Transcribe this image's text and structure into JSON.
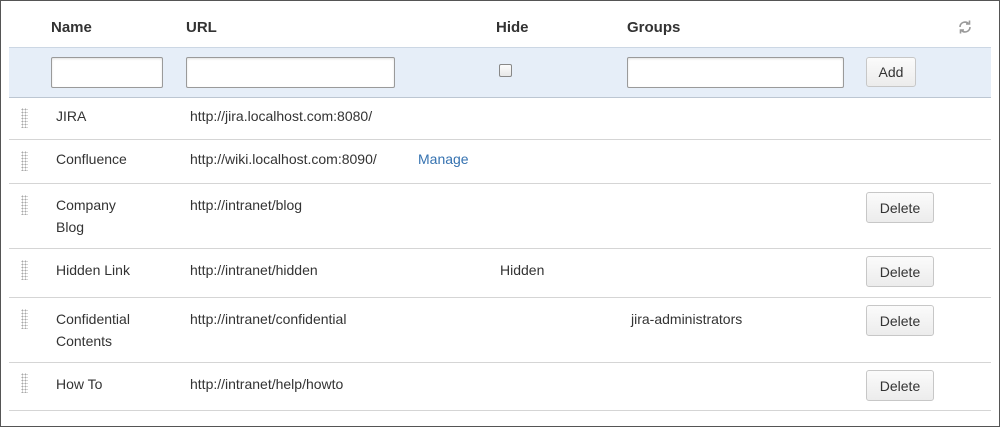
{
  "columns": {
    "name": "Name",
    "url": "URL",
    "hide": "Hide",
    "groups": "Groups"
  },
  "toolbar": {
    "refresh_icon": "refresh-icon"
  },
  "add_form": {
    "name_value": "",
    "url_value": "",
    "hide_checked": false,
    "groups_value": "",
    "add_label": "Add"
  },
  "rows": [
    {
      "name": "JIRA",
      "url": "http://jira.localhost.com:8080/",
      "hide": "",
      "groups": "",
      "action": "",
      "extra_link": ""
    },
    {
      "name": "Confluence",
      "url": "http://wiki.localhost.com:8090/",
      "hide": "",
      "groups": "",
      "action": "",
      "extra_link": "Manage"
    },
    {
      "name": "Company Blog",
      "url": "http://intranet/blog",
      "hide": "",
      "groups": "",
      "action": "Delete",
      "extra_link": ""
    },
    {
      "name": "Hidden Link",
      "url": "http://intranet/hidden",
      "hide": "Hidden",
      "groups": "",
      "action": "Delete",
      "extra_link": ""
    },
    {
      "name": "Confidential Contents",
      "url": "http://intranet/confidential",
      "hide": "",
      "groups": "jira-administrators",
      "action": "Delete",
      "extra_link": ""
    },
    {
      "name": "How To",
      "url": "http://intranet/help/howto",
      "hide": "",
      "groups": "",
      "action": "Delete",
      "extra_link": ""
    }
  ],
  "colors": {
    "link": "#3572b0",
    "add_row_bg": "#e6eef8",
    "border": "#d5d5d5"
  }
}
